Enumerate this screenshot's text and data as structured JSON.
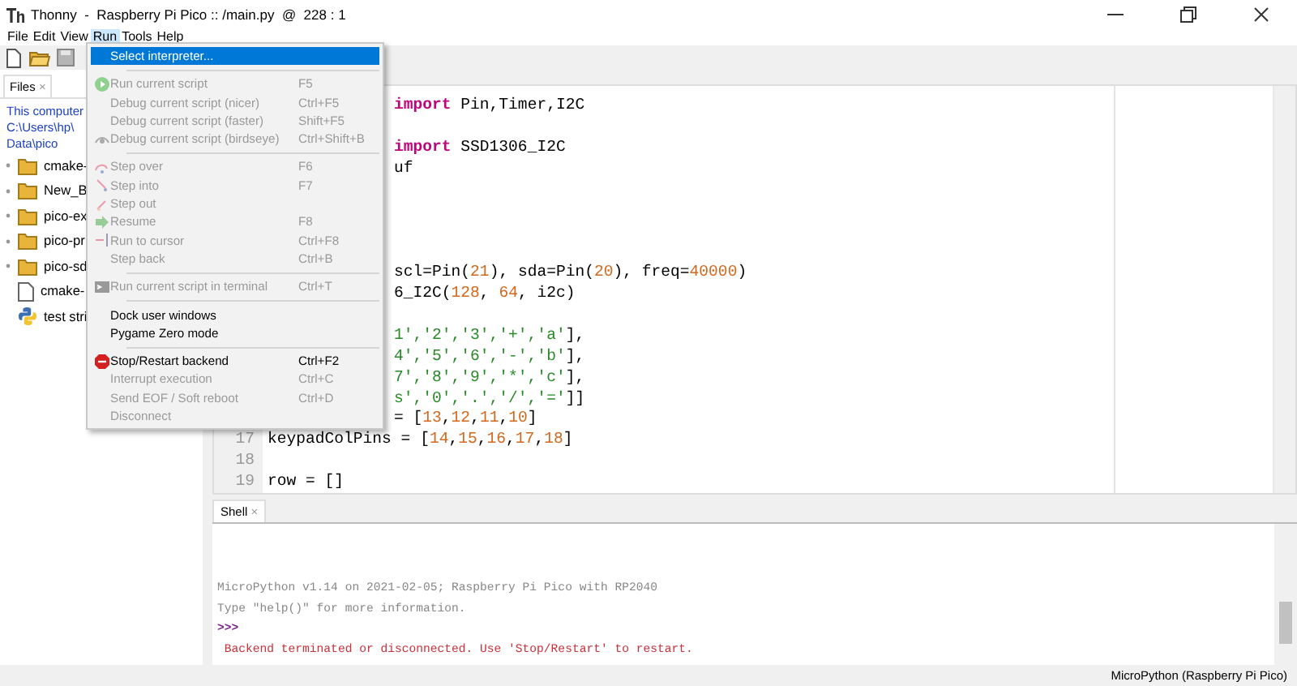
{
  "window": {
    "title": "Thonny  -  Raspberry Pi Pico :: /main.py  @  228 : 1"
  },
  "menu_bar": [
    {
      "label": "File",
      "selected": false
    },
    {
      "label": "Edit",
      "selected": false
    },
    {
      "label": "View",
      "selected": false
    },
    {
      "label": "Run",
      "selected": true
    },
    {
      "label": "Tools",
      "selected": false
    },
    {
      "label": "Help",
      "selected": false
    }
  ],
  "run_menu": [
    {
      "kind": "item",
      "label": "Select interpreter...",
      "disabled": false,
      "selected": true
    },
    {
      "kind": "separator"
    },
    {
      "kind": "item",
      "label": "Run current script",
      "shortcut": "F5",
      "disabled": true,
      "selected": false
    },
    {
      "kind": "item",
      "label": "Debug current script (nicer)",
      "shortcut": "Ctrl+F5",
      "disabled": true,
      "selected": false
    },
    {
      "kind": "item",
      "label": "Debug current script (faster)",
      "shortcut": "Shift+F5",
      "disabled": true,
      "selected": false
    },
    {
      "kind": "item",
      "label": "Debug current script (birdseye)",
      "shortcut": "Ctrl+Shift+B",
      "disabled": true,
      "selected": false
    },
    {
      "kind": "separator"
    },
    {
      "kind": "item",
      "label": "Step over",
      "shortcut": "F6",
      "disabled": true,
      "selected": false
    },
    {
      "kind": "item",
      "label": "Step into",
      "shortcut": "F7",
      "disabled": true,
      "selected": false
    },
    {
      "kind": "item",
      "label": "Step out",
      "disabled": true,
      "selected": false
    },
    {
      "kind": "item",
      "label": "Resume",
      "shortcut": "F8",
      "disabled": true,
      "selected": false
    },
    {
      "kind": "item",
      "label": "Run to cursor",
      "shortcut": "Ctrl+F8",
      "disabled": true,
      "selected": false
    },
    {
      "kind": "item",
      "label": "Step back",
      "shortcut": "Ctrl+B",
      "disabled": true,
      "selected": false
    },
    {
      "kind": "separator"
    },
    {
      "kind": "item",
      "label": "Run current script in terminal",
      "shortcut": "Ctrl+T",
      "disabled": true,
      "selected": false
    },
    {
      "kind": "separator"
    },
    {
      "kind": "item",
      "label": "Dock user windows",
      "disabled": false,
      "selected": false
    },
    {
      "kind": "item",
      "label": "Pygame Zero mode",
      "disabled": false,
      "selected": false
    },
    {
      "kind": "separator"
    },
    {
      "kind": "item",
      "label": "Stop/Restart backend",
      "shortcut": "Ctrl+F2",
      "disabled": false,
      "selected": false
    },
    {
      "kind": "item",
      "label": "Interrupt execution",
      "shortcut": "Ctrl+C",
      "disabled": true,
      "selected": false
    },
    {
      "kind": "item",
      "label": "Send EOF / Soft reboot",
      "shortcut": "Ctrl+D",
      "disabled": true,
      "selected": false
    },
    {
      "kind": "item",
      "label": "Disconnect",
      "disabled": true,
      "selected": false
    }
  ],
  "files": {
    "tab": {
      "label": "Files",
      "close": "×"
    },
    "path": [
      "This computer",
      "C:\\Users\\hp\\",
      "Data\\pico"
    ],
    "tree": [
      {
        "kind": "folder",
        "label": "cmake-"
      },
      {
        "kind": "folder",
        "label": "New_B"
      },
      {
        "kind": "folder",
        "label": "pico-ex"
      },
      {
        "kind": "folder",
        "label": "pico-pr"
      },
      {
        "kind": "folder",
        "label": "pico-sd"
      },
      {
        "kind": "file",
        "label": "cmake-"
      },
      {
        "kind": "python",
        "label": "test stri"
      }
    ]
  },
  "editor": {
    "lines": [
      {
        "kind": "cut",
        "segments": [
          {
            "kind": "keyword",
            "text": "import"
          },
          {
            "kind": "plain",
            "text": " Pin,Timer,I2C"
          }
        ]
      },
      {
        "kind": "hidden"
      },
      {
        "kind": "cut",
        "segments": [
          {
            "kind": "keyword",
            "text": "import"
          },
          {
            "kind": "plain",
            "text": " SSD1306_I2C"
          }
        ]
      },
      {
        "kind": "cut",
        "segments": [
          {
            "kind": "plain",
            "text": "uf"
          }
        ]
      },
      {
        "kind": "hidden"
      },
      {
        "kind": "hidden"
      },
      {
        "kind": "hidden"
      },
      {
        "kind": "hidden"
      },
      {
        "kind": "cut",
        "segments": [
          {
            "kind": "plain",
            "text": "scl=Pin("
          },
          {
            "kind": "number",
            "text": "21"
          },
          {
            "kind": "plain",
            "text": "), sda=Pin("
          },
          {
            "kind": "number",
            "text": "20"
          },
          {
            "kind": "plain",
            "text": "), freq="
          },
          {
            "kind": "number",
            "text": "40000"
          },
          {
            "kind": "plain",
            "text": ")"
          }
        ]
      },
      {
        "kind": "cut",
        "segments": [
          {
            "kind": "plain",
            "text": "6_I2C("
          },
          {
            "kind": "number",
            "text": "128"
          },
          {
            "kind": "plain",
            "text": ", "
          },
          {
            "kind": "number",
            "text": "64"
          },
          {
            "kind": "plain",
            "text": ", i2c)"
          }
        ]
      },
      {
        "kind": "hidden"
      },
      {
        "kind": "cut",
        "segments": [
          {
            "kind": "string",
            "text": "1','2','3','+','a'"
          },
          {
            "kind": "plain",
            "text": "],"
          }
        ]
      },
      {
        "kind": "cut",
        "segments": [
          {
            "kind": "string",
            "text": "4','5','6','-','b'"
          },
          {
            "kind": "plain",
            "text": "],"
          }
        ]
      },
      {
        "kind": "cut",
        "segments": [
          {
            "kind": "string",
            "text": "7','8','9','*','c'"
          },
          {
            "kind": "plain",
            "text": "],"
          }
        ]
      },
      {
        "kind": "cut",
        "segments": [
          {
            "kind": "string",
            "text": "s','0','.','/','='"
          },
          {
            "kind": "plain",
            "text": "]]"
          }
        ]
      },
      {
        "kind": "cut",
        "segments": [
          {
            "kind": "plain",
            "text": "= ["
          },
          {
            "kind": "number",
            "text": "13"
          },
          {
            "kind": "plain",
            "text": ","
          },
          {
            "kind": "number",
            "text": "12"
          },
          {
            "kind": "plain",
            "text": ","
          },
          {
            "kind": "number",
            "text": "11"
          },
          {
            "kind": "plain",
            "text": ","
          },
          {
            "kind": "number",
            "text": "10"
          },
          {
            "kind": "plain",
            "text": "]"
          }
        ]
      },
      {
        "kind": "full",
        "number": "17",
        "segments": [
          {
            "kind": "plain",
            "text": "keypadColPins = ["
          },
          {
            "kind": "number",
            "text": "14"
          },
          {
            "kind": "plain",
            "text": ","
          },
          {
            "kind": "number",
            "text": "15"
          },
          {
            "kind": "plain",
            "text": ","
          },
          {
            "kind": "number",
            "text": "16"
          },
          {
            "kind": "plain",
            "text": ","
          },
          {
            "kind": "number",
            "text": "17"
          },
          {
            "kind": "plain",
            "text": ","
          },
          {
            "kind": "number",
            "text": "18"
          },
          {
            "kind": "plain",
            "text": "]"
          }
        ]
      },
      {
        "kind": "full",
        "number": "18"
      },
      {
        "kind": "full",
        "number": "19",
        "segments": [
          {
            "kind": "plain",
            "text": "row = []"
          }
        ]
      }
    ]
  },
  "shell": {
    "tab": {
      "label": "Shell",
      "close": "×"
    },
    "lines": [
      {
        "kind": "output",
        "text": "MicroPython v1.14 on 2021-02-05; Raspberry Pi Pico with RP2040"
      },
      {
        "kind": "output",
        "text": "Type \"help()\" for more information."
      },
      {
        "kind": "prompt",
        "text": ">>>"
      },
      {
        "kind": "error",
        "text": " Backend terminated or disconnected. Use 'Stop/Restart' to restart."
      }
    ]
  },
  "status_bar": "MicroPython (Raspberry Pi Pico)"
}
